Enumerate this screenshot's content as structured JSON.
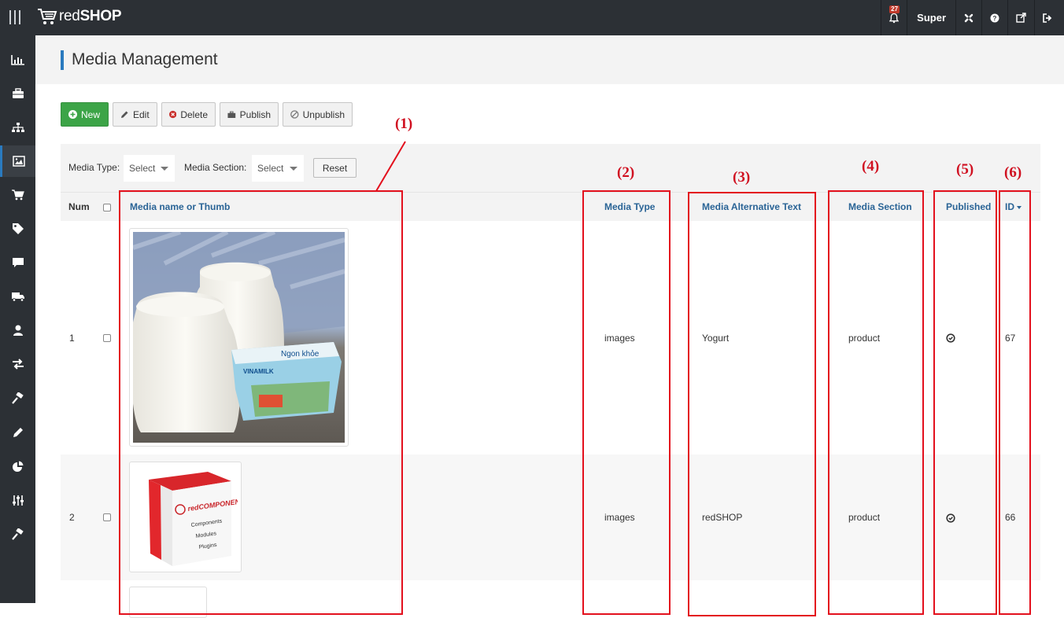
{
  "topbar": {
    "brand_prefix": "red",
    "brand_suffix": "SHOP",
    "notification_count": "27",
    "user_name": "Super"
  },
  "sidebar": {
    "items": [
      "dashboard-icon",
      "briefcase-icon",
      "sitemap-icon",
      "image-icon",
      "cart-icon",
      "tag-icon",
      "comment-icon",
      "truck-icon",
      "user-icon",
      "exchange-icon",
      "gavel-icon",
      "pencil-icon",
      "pie-chart-icon",
      "sliders-icon",
      "hammer-icon"
    ],
    "active_index": 3
  },
  "page": {
    "title": "Media Management"
  },
  "toolbar": {
    "new_label": "New",
    "edit_label": "Edit",
    "delete_label": "Delete",
    "publish_label": "Publish",
    "unpublish_label": "Unpublish"
  },
  "filters": {
    "media_type_label": "Media Type:",
    "media_type_value": "Select",
    "media_section_label": "Media Section:",
    "media_section_value": "Select",
    "reset_label": "Reset"
  },
  "table": {
    "columns": {
      "num": "Num",
      "name": "Media name or Thumb",
      "type": "Media Type",
      "alt_text": "Media Alternative Text",
      "section": "Media Section",
      "published": "Published",
      "id": "ID"
    },
    "rows": [
      {
        "num": "1",
        "type": "images",
        "alt_text": "Yogurt",
        "section": "product",
        "published": true,
        "id": "67"
      },
      {
        "num": "2",
        "type": "images",
        "alt_text": "redSHOP",
        "section": "product",
        "published": true,
        "id": "66"
      }
    ]
  },
  "thumbs": {
    "product_box_brand": "redCOMPONENT",
    "product_box_lines": [
      "Components",
      "Modules",
      "Plugins"
    ],
    "yogurt_pack_brand": "VINAMILK",
    "yogurt_pack_text": "Ngon khỏe"
  },
  "annotations": {
    "labels": [
      "(1)",
      "(2)",
      "(3)",
      "(4)",
      "(5)",
      "(6)"
    ]
  },
  "colors": {
    "topbar": "#2c3035",
    "accent": "#2a7abf",
    "new_button": "#3ca447",
    "annotation_red": "#e3101d"
  }
}
